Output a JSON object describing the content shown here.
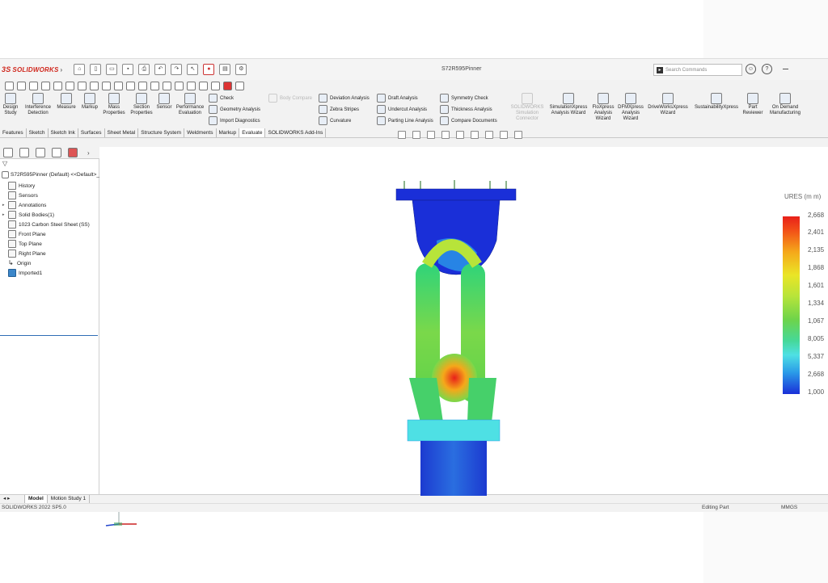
{
  "app": {
    "logo_ds": "3S",
    "logo_text": "SOLIDWORKS",
    "document_title": "S72R595Pinner",
    "search_placeholder": "Search Commands"
  },
  "ribbon": {
    "design_study": "Design Study",
    "interference_detection": "Interference Detection",
    "measure": "Measure",
    "markup": "Markup",
    "mass_properties": "Mass Properties",
    "section_properties": "Section Properties",
    "sensor": "Sensor",
    "performance_evaluation": "Performance Evaluation",
    "check": "Check",
    "geometry_analysis": "Geometry Analysis",
    "import_diagnostics": "Import Diagnostics",
    "body_compare": "Body Compare",
    "deviation_analysis": "Deviation Analysis",
    "zebra_stripes": "Zebra Stripes",
    "curvature": "Curvature",
    "draft_analysis": "Draft Analysis",
    "undercut_analysis": "Undercut Analysis",
    "parting_line_analysis": "Parting Line Analysis",
    "symmetry_check": "Symmetry Check",
    "thickness_analysis": "Thickness Analysis",
    "compare_documents": "Compare Documents",
    "solidworks_simulation_connector": "SOLIDWORKS Simulation Connector",
    "simulationxpress": "SimulationXpress Analysis Wizard",
    "floxpress": "FloXpress Analysis Wizard",
    "dfmxpress": "DFMXpress Analysis Wizard",
    "driveworksxpress": "DriveWorksXpress Wizard",
    "sustainabilityxpress": "SustainabilityXpress",
    "part_reviewer": "Part Reviewer",
    "on_demand_manufacturing": "On Demand Manufacturing"
  },
  "tabs": [
    "Features",
    "Sketch",
    "Sketch Ink",
    "Surfaces",
    "Sheet Metal",
    "Structure System",
    "Weldments",
    "Markup",
    "Evaluate",
    "SOLIDWORKS Add-Ins"
  ],
  "active_tab": "Evaluate",
  "feature_tree": {
    "root": "S72R595Pinner (Default) <<Default>_D",
    "items": [
      {
        "label": "History",
        "icon": "history-icon"
      },
      {
        "label": "Sensors",
        "icon": "sensors-icon"
      },
      {
        "label": "Annotations",
        "icon": "annotations-icon"
      },
      {
        "label": "Solid Bodies(1)",
        "icon": "solid-bodies-icon"
      },
      {
        "label": "1023 Carbon Steel Sheet (SS)",
        "icon": "material-icon"
      },
      {
        "label": "Front Plane",
        "icon": "plane-icon"
      },
      {
        "label": "Top Plane",
        "icon": "plane-icon"
      },
      {
        "label": "Right Plane",
        "icon": "plane-icon"
      },
      {
        "label": "Origin",
        "icon": "origin-icon"
      },
      {
        "label": "Imported1",
        "icon": "imported-body-icon"
      }
    ]
  },
  "legend": {
    "title": "URES (m m)",
    "labels": [
      "2,668",
      "2,401",
      "2,135",
      "1,868",
      "1,601",
      "1,334",
      "1,067",
      "8,005",
      "5,337",
      "2,668",
      "1,000"
    ]
  },
  "bottom_tabs": [
    "Model",
    "Motion Study 1"
  ],
  "status": {
    "version": "SOLIDWORKS 2022 SP5.0",
    "mode": "Editing Part",
    "units": "MMGS"
  },
  "colors": {
    "brand_red": "#d0281e",
    "selection_blue": "#2f6db5"
  }
}
